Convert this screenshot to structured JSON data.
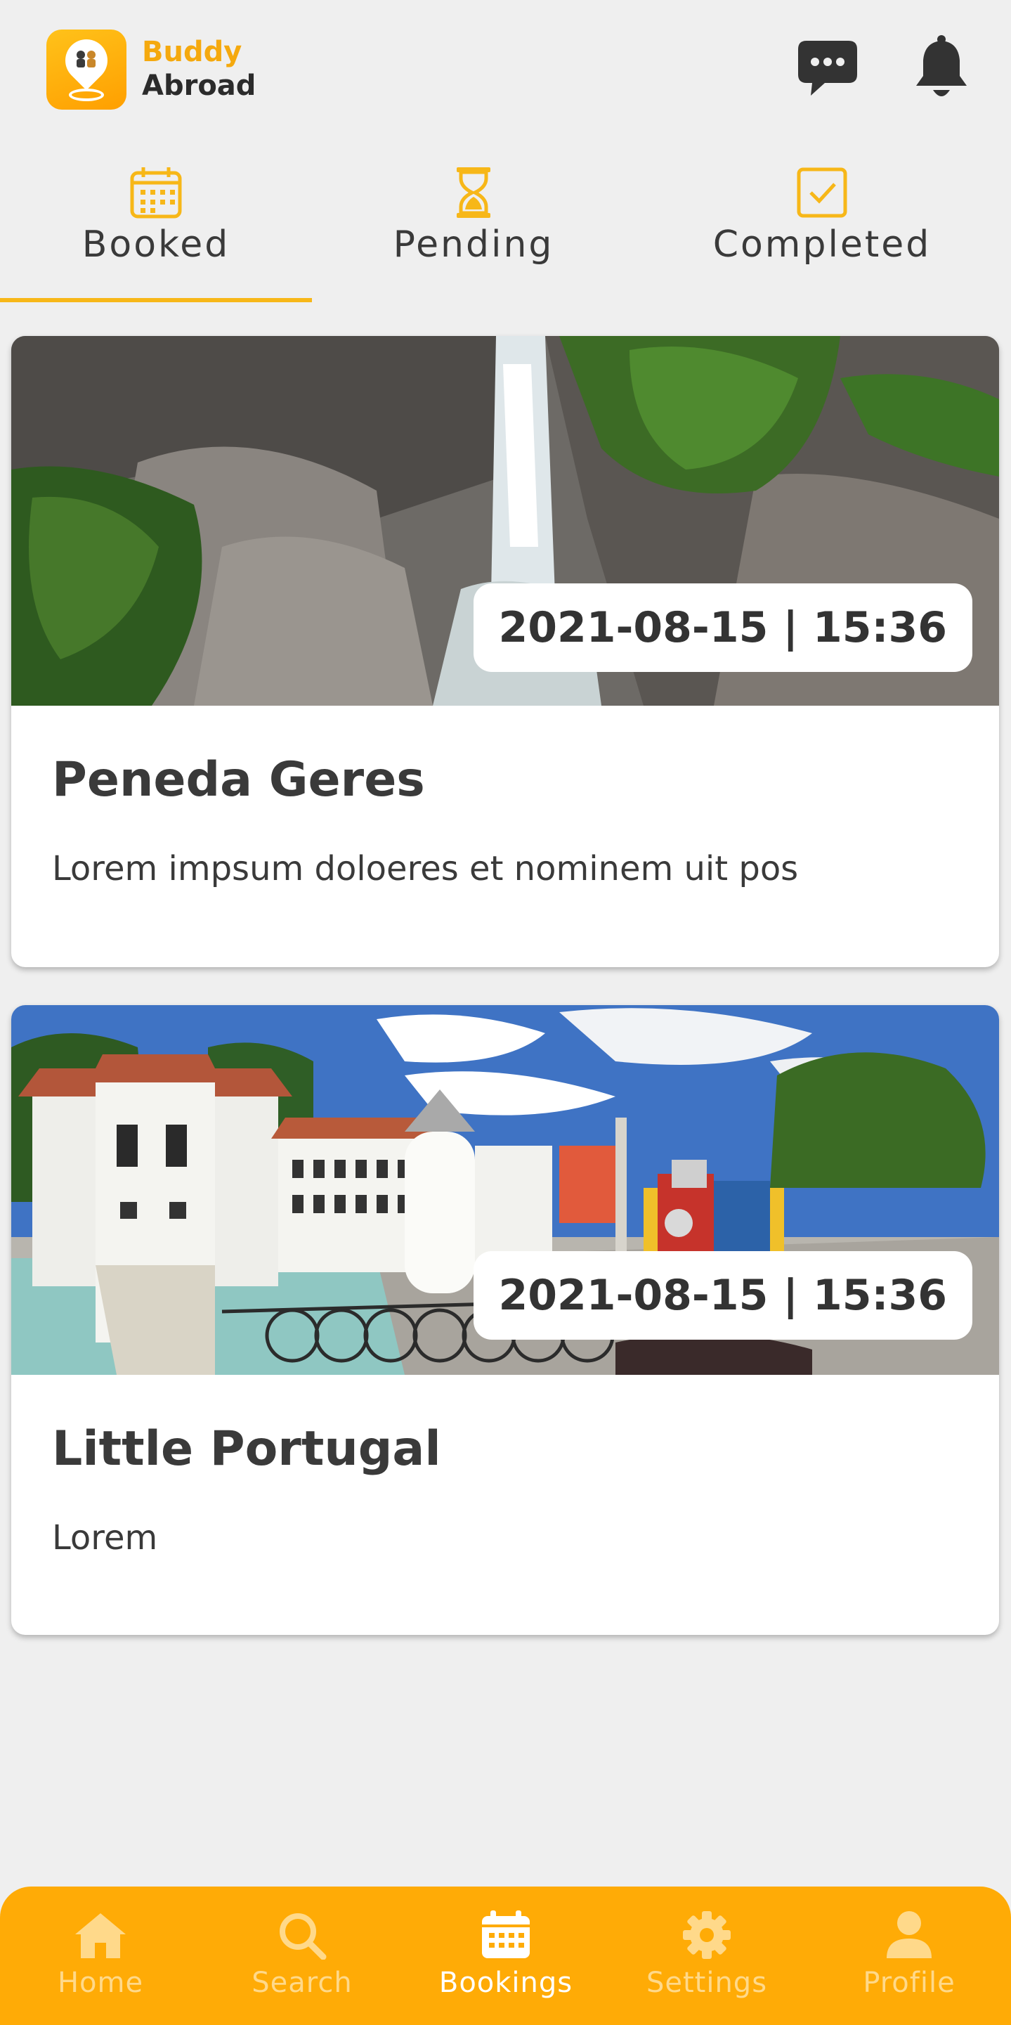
{
  "app": {
    "logo_line1": "Buddy",
    "logo_line2": "Abroad"
  },
  "colors": {
    "accent": "#ffab06",
    "accent_text": "#f5a90e",
    "background": "#efefef"
  },
  "header": {
    "chat_icon": "chat-bubble-icon",
    "notifications_icon": "bell-icon"
  },
  "tabs": [
    {
      "label": "Booked",
      "icon": "calendar-icon",
      "active": true
    },
    {
      "label": "Pending",
      "icon": "hourglass-icon",
      "active": false
    },
    {
      "label": "Completed",
      "icon": "checkbox-icon",
      "active": false
    }
  ],
  "bookings": [
    {
      "title": "Peneda Geres",
      "description": "Lorem impsum doloeres et nominem uit pos",
      "datetime": "2021-08-15 | 15:36",
      "image": "waterfall-photo"
    },
    {
      "title": "Little Portugal",
      "description": "Lorem",
      "datetime": "2021-08-15 | 15:36",
      "image": "miniature-park-photo"
    }
  ],
  "bottom_nav": [
    {
      "label": "Home",
      "icon": "home-icon",
      "active": false
    },
    {
      "label": "Search",
      "icon": "search-icon",
      "active": false
    },
    {
      "label": "Bookings",
      "icon": "calendar-icon",
      "active": true
    },
    {
      "label": "Settings",
      "icon": "gear-icon",
      "active": false
    },
    {
      "label": "Profile",
      "icon": "person-icon",
      "active": false
    }
  ]
}
